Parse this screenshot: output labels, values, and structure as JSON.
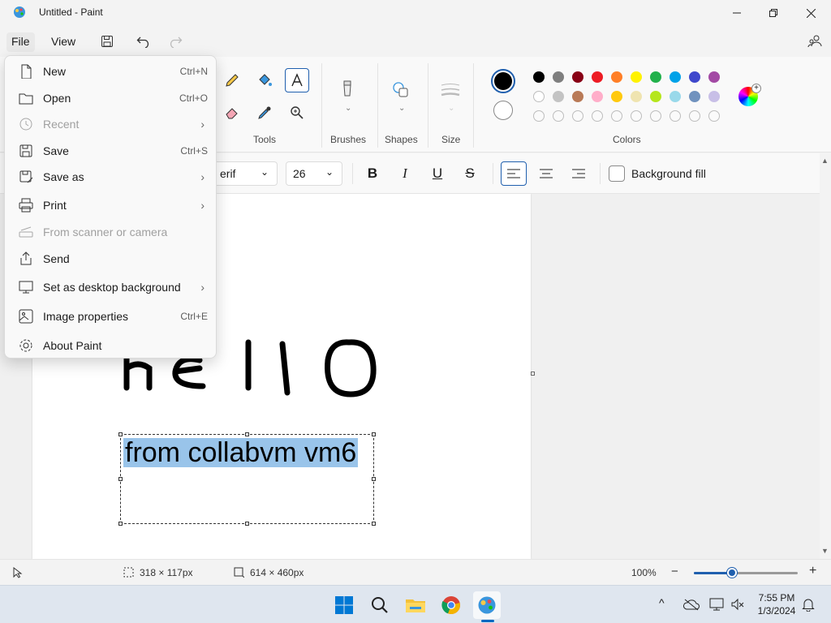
{
  "window": {
    "title": "Untitled - Paint"
  },
  "menubar": {
    "file_label": "File",
    "view_label": "View"
  },
  "ribbon": {
    "groups": {
      "tools": "Tools",
      "brushes": "Brushes",
      "shapes": "Shapes",
      "size": "Size",
      "colors": "Colors"
    },
    "colors": {
      "primary": "#000000",
      "secondary": "#ffffff",
      "row1": [
        "#000000",
        "#7f7f7f",
        "#880015",
        "#ed1c24",
        "#ff7f27",
        "#fff200",
        "#22b14c",
        "#00a2e8",
        "#3f48cc",
        "#a349a4"
      ],
      "row2": [
        "#ffffff",
        "#c3c3c3",
        "#b97a57",
        "#ffaec9",
        "#ffc90e",
        "#efe4b0",
        "#b5e61d",
        "#99d9ea",
        "#7092be",
        "#c8bfe7"
      ]
    }
  },
  "textbar": {
    "font_name": "erif",
    "font_size": "26",
    "bold": "B",
    "italic": "I",
    "underline": "U",
    "strike": "S",
    "background_fill": "Background fill"
  },
  "canvas": {
    "drawn_text": "hello",
    "text_box_content": "from collabvm vm6"
  },
  "status": {
    "selection_size": "318 × 117px",
    "canvas_size": "614 × 460px",
    "zoom": "100%",
    "zoom_level": 0.37
  },
  "file_menu": {
    "items": [
      {
        "label": "New",
        "shortcut": "Ctrl+N",
        "icon": "new-file-icon",
        "disabled": false,
        "submenu": false
      },
      {
        "label": "Open",
        "shortcut": "Ctrl+O",
        "icon": "open-folder-icon",
        "disabled": false,
        "submenu": false
      },
      {
        "label": "Recent",
        "shortcut": "",
        "icon": "clock-icon",
        "disabled": true,
        "submenu": true
      },
      {
        "label": "Save",
        "shortcut": "Ctrl+S",
        "icon": "save-icon",
        "disabled": false,
        "submenu": false
      },
      {
        "label": "Save as",
        "shortcut": "",
        "icon": "save-as-icon",
        "disabled": false,
        "submenu": true
      },
      {
        "label": "Print",
        "shortcut": "",
        "icon": "printer-icon",
        "disabled": false,
        "submenu": true
      },
      {
        "label": "From scanner or camera",
        "shortcut": "",
        "icon": "scanner-icon",
        "disabled": true,
        "submenu": false
      },
      {
        "label": "Send",
        "shortcut": "",
        "icon": "share-icon",
        "disabled": false,
        "submenu": false
      },
      {
        "label": "Set as desktop background",
        "shortcut": "",
        "icon": "desktop-icon",
        "disabled": false,
        "submenu": true
      },
      {
        "label": "Image properties",
        "shortcut": "Ctrl+E",
        "icon": "image-properties-icon",
        "disabled": false,
        "submenu": false
      },
      {
        "label": "About Paint",
        "shortcut": "",
        "icon": "gear-icon",
        "disabled": false,
        "submenu": false
      }
    ]
  },
  "taskbar": {
    "time": "7:55 PM",
    "date": "1/3/2024"
  }
}
